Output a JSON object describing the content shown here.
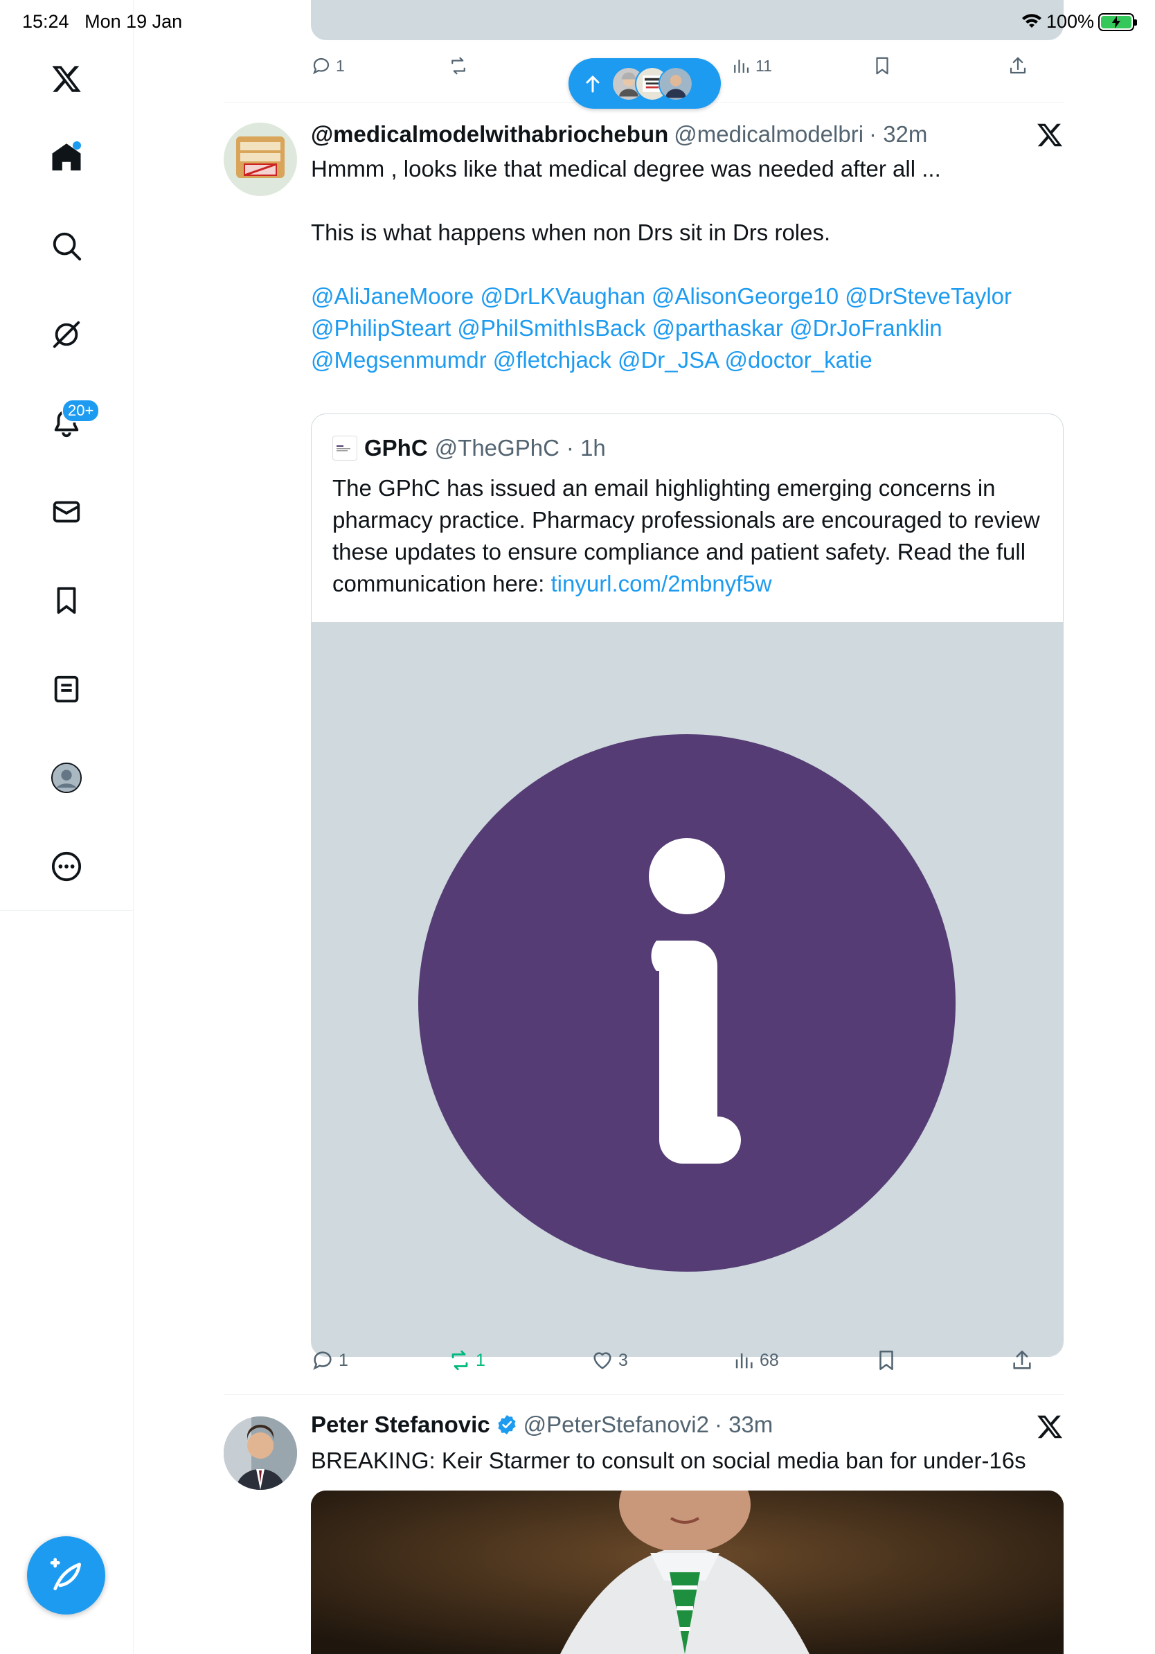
{
  "status_bar": {
    "time": "15:24",
    "date": "Mon 19 Jan",
    "battery": "100%"
  },
  "sidebar": {
    "notifications_badge": "20+",
    "items": [
      {
        "name": "home",
        "icon": "home-icon"
      },
      {
        "name": "explore",
        "icon": "search-icon"
      },
      {
        "name": "grok",
        "icon": "grok-icon"
      },
      {
        "name": "notifications",
        "icon": "bell-icon"
      },
      {
        "name": "messages",
        "icon": "mail-icon"
      },
      {
        "name": "bookmarks",
        "icon": "bookmark-icon"
      },
      {
        "name": "lists",
        "icon": "list-icon"
      },
      {
        "name": "profile",
        "icon": "profile-avatar-icon"
      },
      {
        "name": "more",
        "icon": "more-circle-icon"
      }
    ],
    "compose_icon": "compose-feather-icon"
  },
  "top_tweet_actions": {
    "replies": "1",
    "views": "11"
  },
  "tweet1": {
    "name": "@medicalmodelwithabriochebun",
    "handle": "@medicalmodelbri",
    "time": "· 32m",
    "text": "Hmmm , looks like that medical degree was needed after all ...\n\nThis is what happens when non Drs sit in Drs roles.",
    "mentions": "@AliJaneMoore @DrLKVaughan @AlisonGeorge10 @DrSteveTaylor @PhilipSteart @PhilSmithIsBack @parthaskar @DrJoFranklin @Megsenmumdr @fletchjack @Dr_JSA @doctor_katie",
    "quote": {
      "name": "GPhC",
      "handle": "@TheGPhC",
      "time": "· 1h",
      "text": "The GPhC has issued an email highlighting emerging concerns in pharmacy practice. Pharmacy professionals are encouraged to review these updates to ensure compliance and patient safety. Read the full communication here: ",
      "link": "tinyurl.com/2mbnyf5w",
      "image_color": "#553c74"
    },
    "actions": {
      "replies": "1",
      "reposts": "1",
      "likes": "3",
      "views": "68"
    }
  },
  "tweet2": {
    "name": "Peter Stefanovic",
    "handle": "@PeterStefanovi2",
    "time": "· 33m",
    "text": "BREAKING: Keir Starmer to consult on social media ban for under-16s"
  },
  "colors": {
    "accent": "#1d9bf0",
    "secondary_text": "#536471",
    "repost_active": "#00ba7c"
  }
}
